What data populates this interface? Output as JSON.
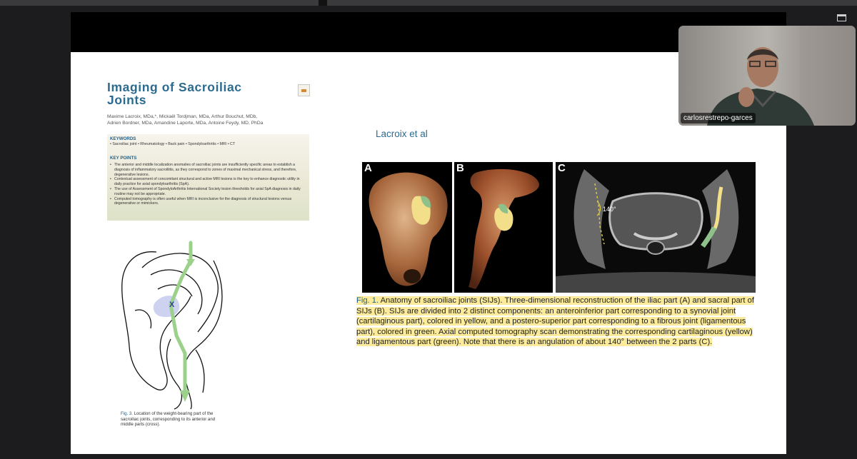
{
  "video": {
    "name": "carlosrestrepo-garces"
  },
  "paper": {
    "title": "Imaging of Sacroiliac Joints",
    "authors_line1": "Maxime Lacroix, MDa,*, Mickaël Tordjman, MDa, Arthur Bouchut, MDb,",
    "authors_line2": "Adrien Bordner, MDa, Amandine Laporte, MDa, Antoine Feydy, MD, PhDa",
    "keywords_heading": "KEYWORDS",
    "keywords": "• Sacroiliac joint • Rheumatology • Back pain • Spondyloarthritis • MRI • CT",
    "keypoints_heading": "KEY POINTS",
    "keypoints": [
      "The anterior and middle localization anomalies of sacroiliac joints are insufficiently specific areas to establish a diagnosis of inflammatory sacroiliitis, as they correspond to zones of maximal mechanical stress, and therefore, degenerative lesions.",
      "Contextual assessment of concomitant structural and active MRI lesions is the key to enhance diagnostic utility in daily practice for axial spondyloarthritis (SpA).",
      "The use of Assessment of SpondyloArthritis International Society lesion thresholds for axial SpA diagnosis in daily routine may not be appropriate.",
      "Computed tomography is often useful when MRI is inconclusive for the diagnosis of structural lesions versus degenerative or mimickers."
    ],
    "fig3_label": "Fig. 3.",
    "fig3_caption": "Location of the weight-bearing part of the sacroiliac joints, corresponding to its anterior and middle parts (cross).",
    "diagram_marker": "X"
  },
  "slide": {
    "heading": "Lacroix et al",
    "panel_labels": [
      "A",
      "B",
      "C"
    ],
    "angle_label": "140°",
    "fig1_label": "Fig. 1.",
    "fig1_caption": "Anatomy of sacroiliac joints (SIJs). Three-dimensional reconstruction of the iliac part (A) and sacral part of SIJs (B). SIJs are divided into 2 distinct components: an anteroinferior part corresponding to a synovial joint (cartilaginous part), colored in yellow, and a postero-superior part corresponding to a fibrous joint (ligamentous part), colored in green. Axial computed tomography scan demonstrating the corresponding cartilaginous (yellow) and ligamentous part (green). Note that there is an angulation of about 140° between the 2 parts (C)."
  },
  "colors": {
    "title_blue": "#2b6b90",
    "highlight": "#fbeb9b",
    "cartilage_yellow": "#f3df8a",
    "ligament_green": "#8fc08a"
  }
}
